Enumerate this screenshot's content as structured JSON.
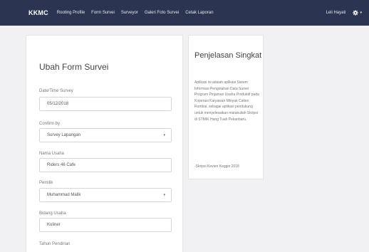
{
  "navbar": {
    "brand": "KKMC",
    "items": [
      "Rooting Profile",
      "Form Survei",
      "Surveyor",
      "Galeri Foto Survei",
      "Cetak Laporan"
    ],
    "user": "Leli Hayati",
    "settings_icon": "gear-icon",
    "color": "#2b3551"
  },
  "form": {
    "title": "Ubah Form Survei",
    "fields": [
      {
        "label": "Date/Time Survey",
        "value": "05/12/2018"
      },
      {
        "label": "Confirm by",
        "value": "Survey Lapangan"
      },
      {
        "label": "Nama Usaha",
        "value": "Riders 46 Cafe"
      },
      {
        "label": "Pemilik",
        "value": "Muhammad Malik"
      },
      {
        "label": "Bidang Usaha",
        "value": "Kuliner"
      },
      {
        "label": "Tahun Pendirian",
        "value": ""
      }
    ]
  },
  "info": {
    "title": "Penjelasan Singkat",
    "body": "Aplikasi ini adalah aplikasi Sistem Informasi Pengolahan Data Survei Program Pinjaman Usaha Produktif pada Koperasi Karyawan Minyak Caltex Rumbai, sebagai aplikasi pendukung untuk menyelesaikan matakuliah Skripsi di STMIK Hang Tuah Pekanbaru.",
    "signature": "-Skripsi Kevien Keggin 2018"
  }
}
